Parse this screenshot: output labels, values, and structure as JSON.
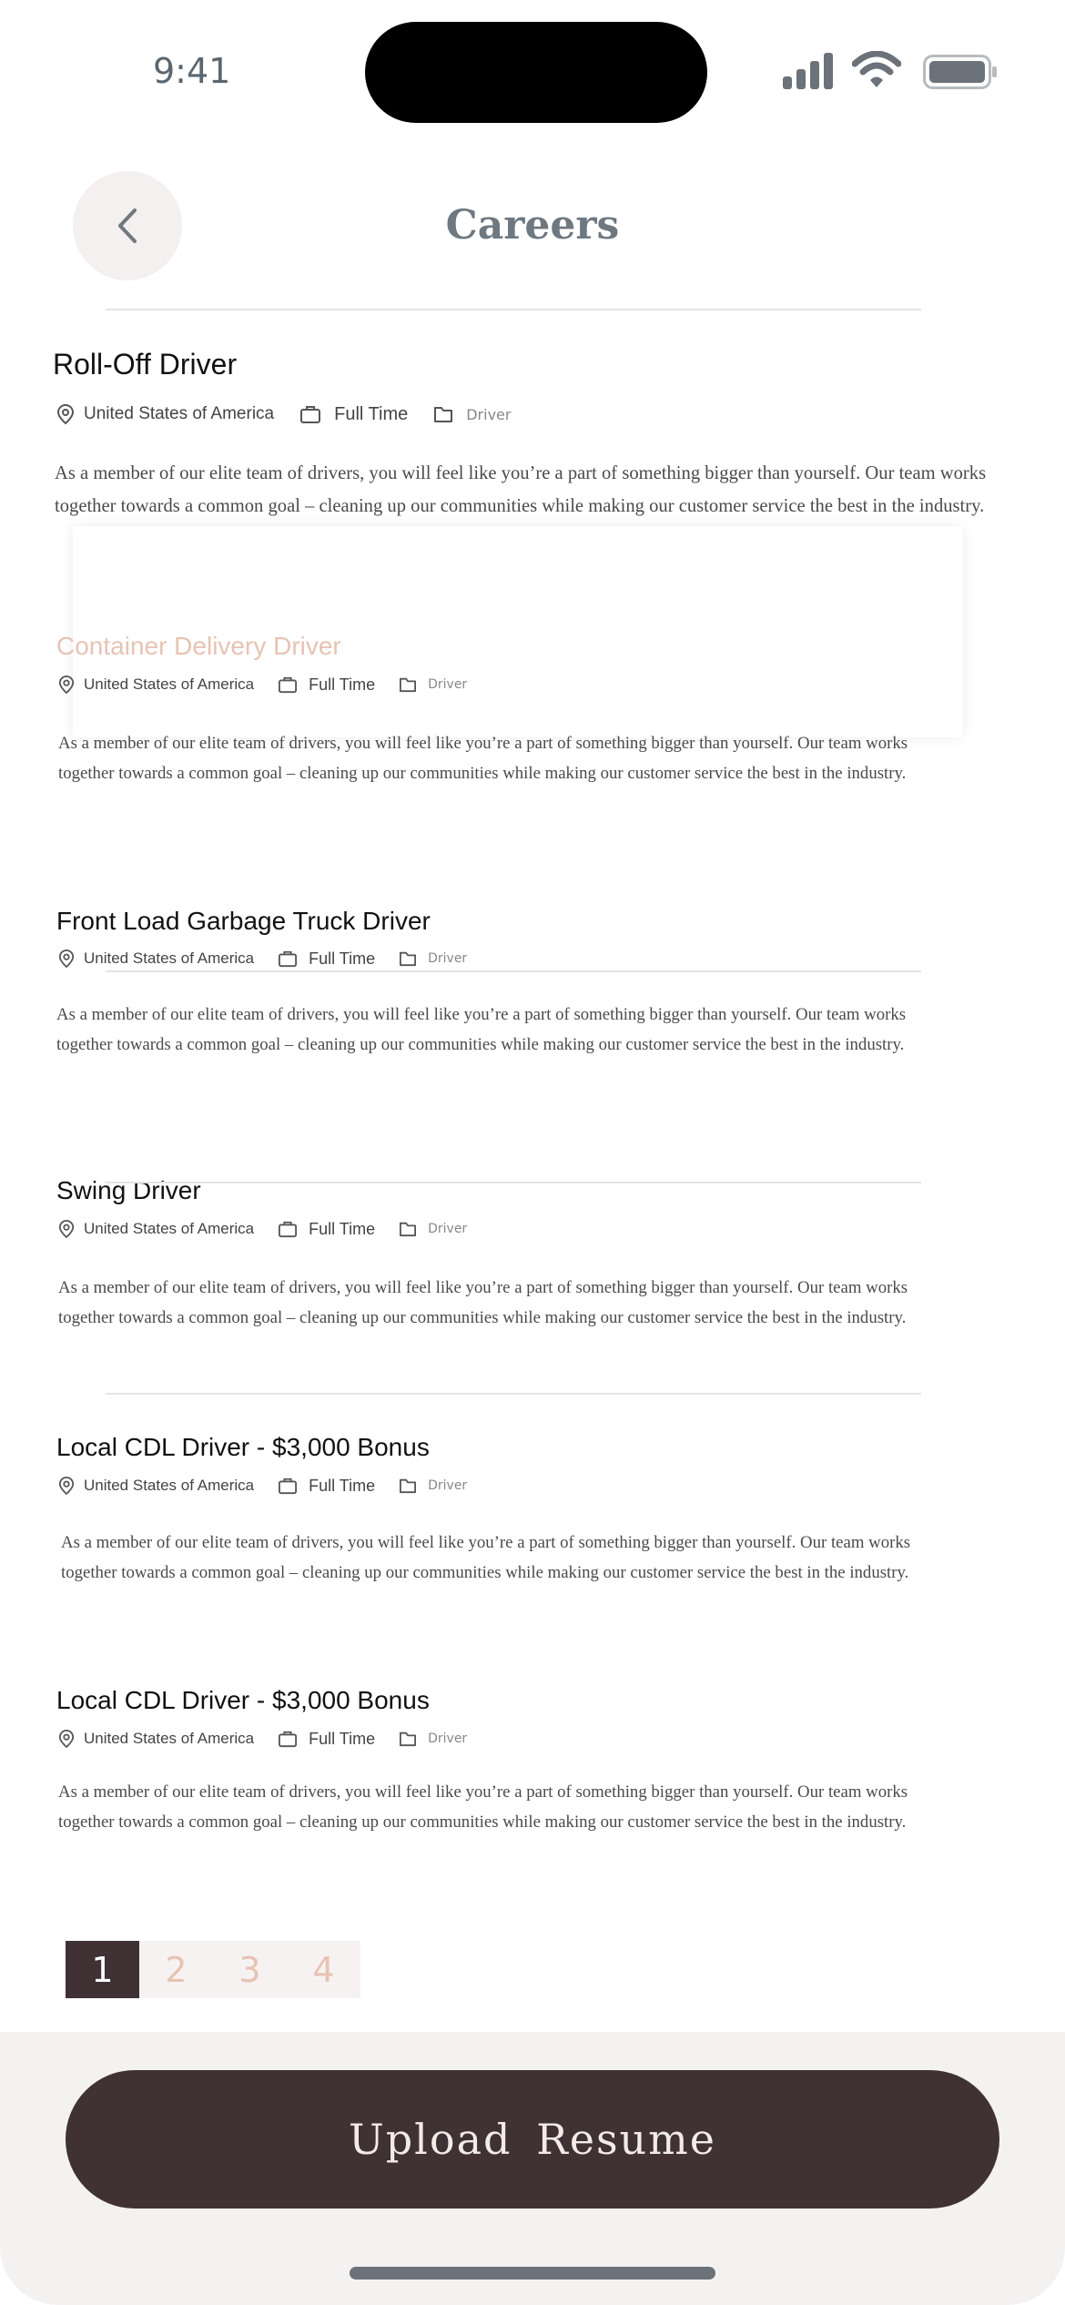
{
  "status_bar": {
    "time": "9:41"
  },
  "header": {
    "title": "Careers"
  },
  "jobs": [
    {
      "title": "Roll-Off Driver",
      "location": "United States of America",
      "type": "Full Time",
      "category": "Driver",
      "description_1": "As a member of our elite team of drivers, you will feel like you’re a part of something bigger than yourself. Our team works",
      "description_2": "together towards a common goal – cleaning up our communities while making our customer service the best in the industry."
    },
    {
      "title": "Container Delivery Driver",
      "location": "United States of America",
      "type": "Full Time",
      "category": "Driver",
      "description_1": "As a member of our elite team of drivers, you will feel like you’re a part of something bigger than yourself. Our team works",
      "description_2": "together towards a common goal – cleaning up our communities while making our customer service the best in the industry."
    },
    {
      "title": "Front Load Garbage Truck Driver",
      "location": "United States of America",
      "type": "Full Time",
      "category": "Driver",
      "description_1": "As a member of our elite team of drivers, you will feel like you’re a part of something bigger than yourself. Our team works",
      "description_2": "together towards a common goal – cleaning up our communities while making our customer service the best in the industry."
    },
    {
      "title": "Swing Driver",
      "location": "United States of America",
      "type": "Full Time",
      "category": "Driver",
      "description_1": "As a member of our elite team of drivers, you will feel like you’re a part of something bigger than yourself. Our team works",
      "description_2": "together towards a common goal – cleaning up our communities while making our customer service the best in the industry."
    },
    {
      "title": "Local CDL Driver - $3,000 Bonus",
      "location": "United States of America",
      "type": "Full Time",
      "category": "Driver",
      "description_1": "As a member of our elite team of drivers, you will feel like you’re a part of something bigger than yourself. Our team works",
      "description_2": "together towards a common goal – cleaning up our communities while making our customer service the best in the industry."
    },
    {
      "title": "Local CDL Driver - $3,000 Bonus",
      "location": "United States of America",
      "type": "Full Time",
      "category": "Driver",
      "description_1": "As a member of our elite team of drivers, you will feel like you’re a part of something bigger than yourself. Our team works",
      "description_2": "together towards a common goal – cleaning up our communities while making our customer service the best in the industry."
    }
  ],
  "pagination": {
    "pages": [
      "1",
      "2",
      "3",
      "4"
    ],
    "current": "1"
  },
  "footer": {
    "upload_label": "Upload  Resume"
  },
  "colors": {
    "accent_dark": "#3f3134",
    "accent_peach": "#e7c3b4",
    "header_text": "#6e7880"
  }
}
